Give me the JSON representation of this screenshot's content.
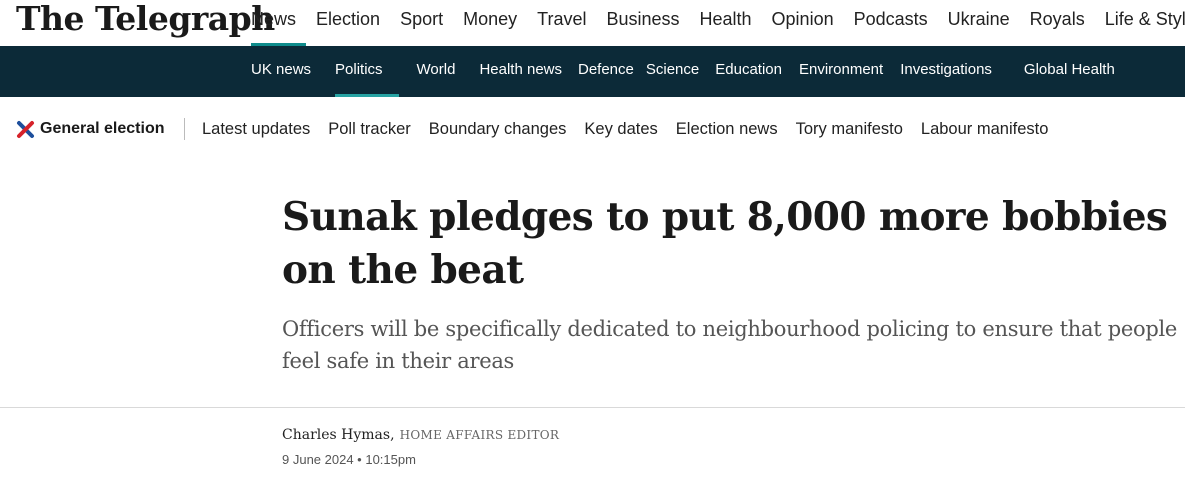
{
  "brand": {
    "logo": "The Telegraph"
  },
  "top_nav": {
    "items": [
      "News",
      "Election",
      "Sport",
      "Money",
      "Travel",
      "Business",
      "Health",
      "Opinion",
      "Podcasts",
      "Ukraine",
      "Royals",
      "Life & Style"
    ],
    "active": "News"
  },
  "section_nav": {
    "items": [
      "UK news",
      "Politics",
      "World",
      "Health news",
      "Defence",
      "Science",
      "Education",
      "Environment",
      "Investigations",
      "Global Health"
    ],
    "active": "Politics"
  },
  "election_bar": {
    "label": "General election",
    "links": [
      "Latest updates",
      "Poll tracker",
      "Boundary changes",
      "Key dates",
      "Election news",
      "Tory manifesto",
      "Labour manifesto"
    ]
  },
  "article": {
    "headline": "Sunak pledges to put 8,000 more bobbies on the beat",
    "standfirst": "Officers will be specifically dedicated to neighbourhood policing to ensure that people feel safe in their areas",
    "author": "Charles Hymas,",
    "author_role": "HOME AFFAIRS EDITOR",
    "date": "9 June 2024 • 10:15pm"
  },
  "colors": {
    "brand_bar": "#0c2a38",
    "accent": "#0f8c8c",
    "election_red": "#d6222a",
    "election_blue": "#1d4f9c"
  }
}
